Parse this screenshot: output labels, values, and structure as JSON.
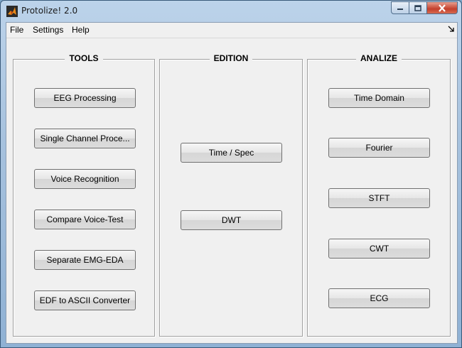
{
  "window": {
    "title": "Protolize! 2.0",
    "icon": "matlab-logo-icon"
  },
  "menu": {
    "items": [
      "File",
      "Settings",
      "Help"
    ],
    "dock_icon": "dock-arrow-icon"
  },
  "panels": {
    "tools": {
      "title": "TOOLS",
      "buttons": [
        "EEG Processing",
        "Single Channel Proce...",
        "Voice Recognition",
        "Compare Voice-Test",
        "Separate EMG-EDA",
        "EDF to ASCII Converter"
      ]
    },
    "edition": {
      "title": "EDITION",
      "buttons": [
        "Time / Spec",
        "DWT"
      ]
    },
    "analize": {
      "title": "ANALIZE",
      "buttons": [
        "Time Domain",
        "Fourier",
        "STFT",
        "CWT",
        "ECG"
      ]
    }
  },
  "colors": {
    "window_bg": "#f0f0f0",
    "titlebar": "#a7c2de",
    "close_button": "#c4402c"
  }
}
